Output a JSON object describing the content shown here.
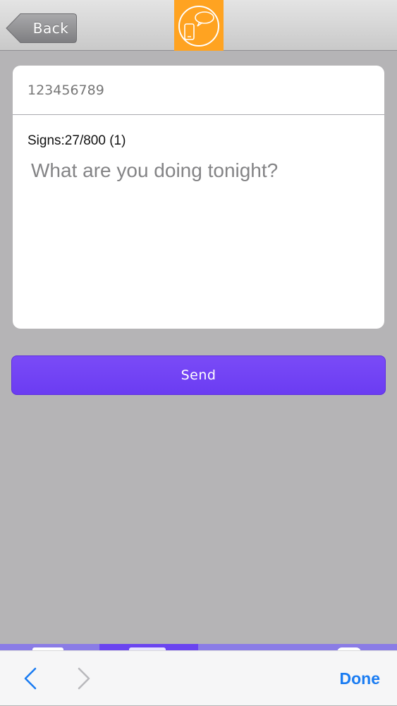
{
  "header": {
    "back_label": "Back",
    "logo_icon": "phone-speech-bubble-icon",
    "logo_color": "#ffa321"
  },
  "form": {
    "phone_number": "123456789",
    "signs_counter": "Signs:27/800 (1)",
    "message": "What are you doing tonight?"
  },
  "actions": {
    "send_label": "Send",
    "send_color": "#7244f5"
  },
  "browser_toolbar": {
    "back_icon": "chevron-left-icon",
    "forward_icon": "chevron-right-icon",
    "done_label": "Done",
    "accent_color": "#1a7cf2"
  }
}
